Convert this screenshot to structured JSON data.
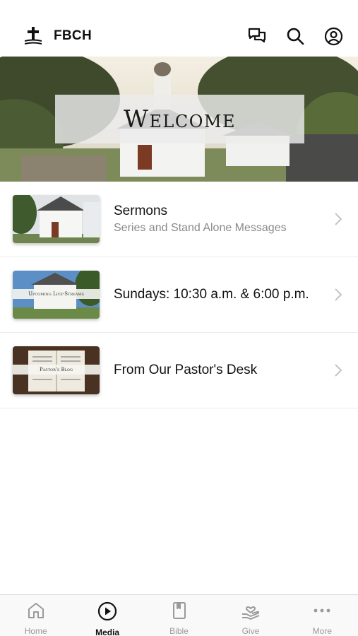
{
  "app": {
    "brand": "FBCH"
  },
  "header": {
    "icons": [
      "cross-logo-icon",
      "chat-bubbles-icon",
      "search-icon",
      "account-icon"
    ]
  },
  "hero": {
    "title": "Welcome"
  },
  "items": [
    {
      "title": "Sermons",
      "subtitle": "Series and Stand Alone Messages",
      "thumb_caption": ""
    },
    {
      "title": "Sundays: 10:30 a.m. & 6:00 p.m.",
      "subtitle": "",
      "thumb_caption": "Upcoming Live-Streams"
    },
    {
      "title": "From Our Pastor's Desk",
      "subtitle": "",
      "thumb_caption": "Pastor's Blog"
    }
  ],
  "tabs": [
    {
      "label": "Home",
      "icon": "home-icon",
      "active": false
    },
    {
      "label": "Media",
      "icon": "play-circle-icon",
      "active": true
    },
    {
      "label": "Bible",
      "icon": "bible-icon",
      "active": false
    },
    {
      "label": "Give",
      "icon": "give-hand-icon",
      "active": false
    },
    {
      "label": "More",
      "icon": "more-dots-icon",
      "active": false
    }
  ],
  "colors": {
    "active": "#111111",
    "inactive": "#9a9a9a",
    "divider": "#ececec"
  }
}
